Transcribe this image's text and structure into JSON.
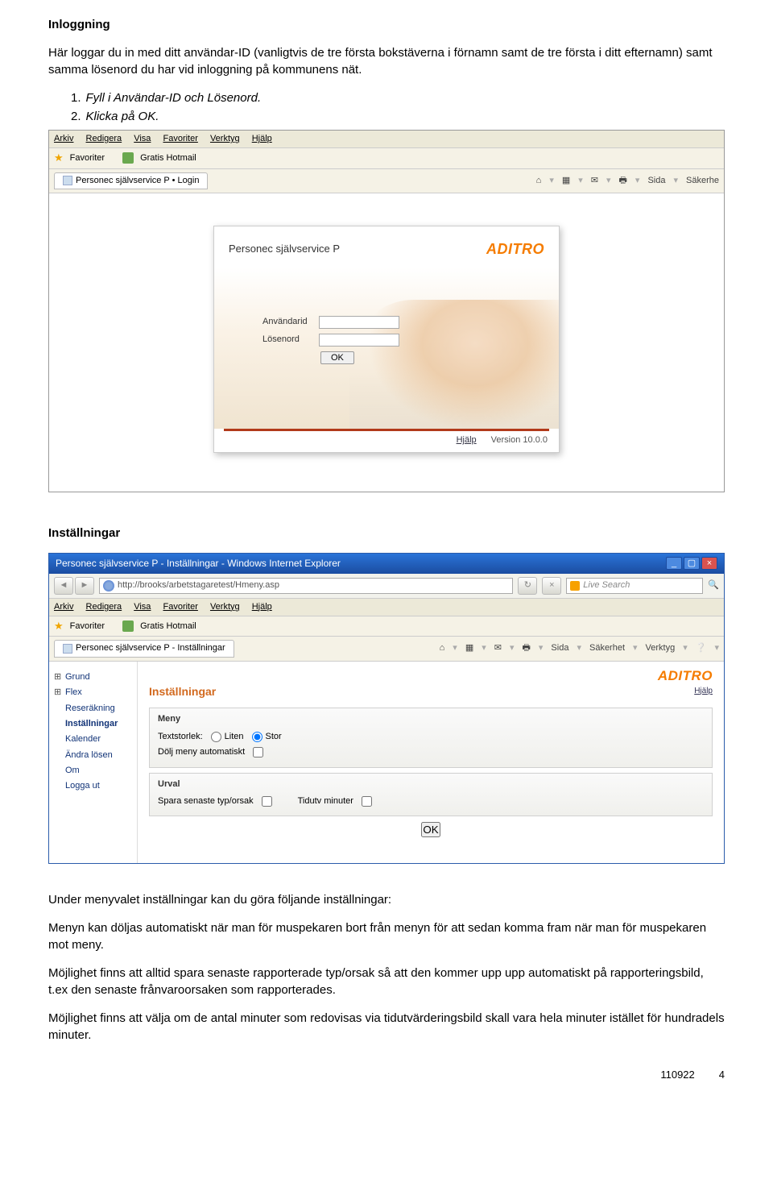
{
  "h1": "Inloggning",
  "intro": "Här loggar du in med ditt användar-ID (vanligtvis de tre första bokstäverna i förnamn samt de tre första i ditt efternamn) samt samma lösenord du har vid inloggning på kommunens nät.",
  "steps": [
    "Fyll i Användar-ID och Lösenord.",
    "Klicka på OK."
  ],
  "ss1": {
    "menus": [
      "Arkiv",
      "Redigera",
      "Visa",
      "Favoriter",
      "Verktyg",
      "Hjälp"
    ],
    "fav_label": "Favoriter",
    "fav_link": "Gratis Hotmail",
    "tab_label": "Personec självservice P • Login",
    "tool_sida": "Sida",
    "tool_sakerhe": "Säkerhe",
    "login_title": "Personec självservice P",
    "logo": "ADITRO",
    "field_user": "Användarid",
    "field_pass": "Lösenord",
    "ok": "OK",
    "help": "Hjälp",
    "version": "Version 10.0.0"
  },
  "h2": "Inställningar",
  "ss2": {
    "window_title": "Personec självservice P - Inställningar - Windows Internet Explorer",
    "url": "http://brooks/arbetstagaretest/Hmeny.asp",
    "search_placeholder": "Live Search",
    "menus": [
      "Arkiv",
      "Redigera",
      "Visa",
      "Favoriter",
      "Verktyg",
      "Hjälp"
    ],
    "fav_label": "Favoriter",
    "fav_link": "Gratis Hotmail",
    "tab_label": "Personec självservice P - Inställningar",
    "tool_labels": [
      "Sida",
      "Säkerhet",
      "Verktyg"
    ],
    "leftnav": [
      "Grund",
      "Flex",
      "Reseräkning",
      "Inställningar",
      "Kalender",
      "Ändra lösen",
      "Om",
      "Logga ut"
    ],
    "leftnav_selected_index": 3,
    "leftnav_plus_indices": [
      0,
      1
    ],
    "logo": "ADITRO",
    "help": "Hjälp",
    "panel_title": "Inställningar",
    "panel1": {
      "legend": "Meny",
      "text_size_label": "Textstorlek:",
      "opt_small": "Liten",
      "opt_large": "Stor",
      "hide_menu": "Dölj meny automatiskt"
    },
    "panel2": {
      "legend": "Urval",
      "save_last": "Spara senaste typ/orsak",
      "tidutv": "Tidutv minuter"
    },
    "ok": "OK"
  },
  "para1": "Under menyvalet inställningar kan du göra följande inställningar:",
  "para2": "Menyn kan döljas automatiskt när man för muspekaren bort från menyn för att sedan komma fram när man för muspekaren mot meny.",
  "para3": "Möjlighet finns att alltid spara senaste rapporterade typ/orsak så att den kommer upp upp automatiskt på rapporteringsbild, t.ex den senaste frånvaroorsaken som rapporterades.",
  "para4": "Möjlighet finns att välja om de antal minuter som redovisas via tidutvärderingsbild skall vara hela minuter istället för hundradels minuter.",
  "footer_date": "110922",
  "footer_page": "4"
}
